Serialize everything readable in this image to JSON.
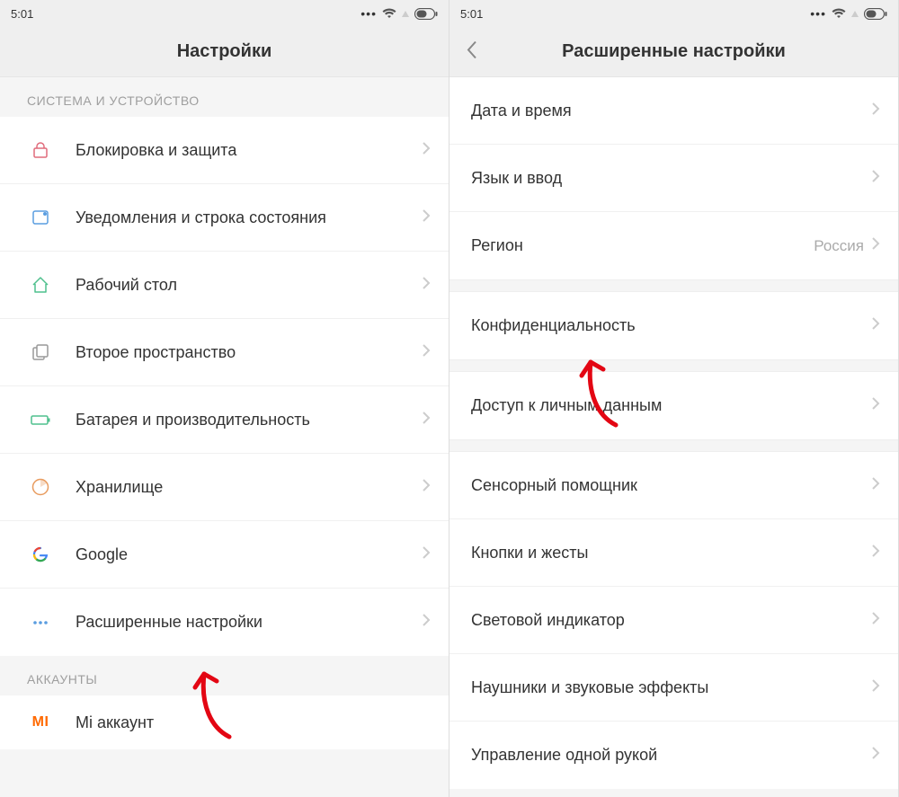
{
  "status": {
    "time": "5:01"
  },
  "left": {
    "title": "Настройки",
    "section1_header": "СИСТЕМА И УСТРОЙСТВО",
    "items": [
      {
        "label": "Блокировка и защита",
        "icon": "lock"
      },
      {
        "label": "Уведомления и строка состояния",
        "icon": "notify"
      },
      {
        "label": "Рабочий стол",
        "icon": "home"
      },
      {
        "label": "Второе пространство",
        "icon": "second"
      },
      {
        "label": "Батарея и производительность",
        "icon": "battery"
      },
      {
        "label": "Хранилище",
        "icon": "storage"
      },
      {
        "label": "Google",
        "icon": "google"
      },
      {
        "label": "Расширенные настройки",
        "icon": "more"
      }
    ],
    "section2_header": "АККАУНТЫ",
    "items2": [
      {
        "label": "Mi аккаунт",
        "icon": "mi"
      }
    ]
  },
  "right": {
    "title": "Расширенные настройки",
    "groups": [
      [
        {
          "label": "Дата и время"
        },
        {
          "label": "Язык и ввод"
        },
        {
          "label": "Регион",
          "value": "Россия"
        }
      ],
      [
        {
          "label": "Конфиденциальность"
        }
      ],
      [
        {
          "label": "Доступ к личным данным"
        }
      ],
      [
        {
          "label": "Сенсорный помощник"
        },
        {
          "label": "Кнопки и жесты"
        },
        {
          "label": "Световой индикатор"
        },
        {
          "label": "Наушники и звуковые эффекты"
        },
        {
          "label": "Управление одной рукой"
        }
      ]
    ]
  }
}
